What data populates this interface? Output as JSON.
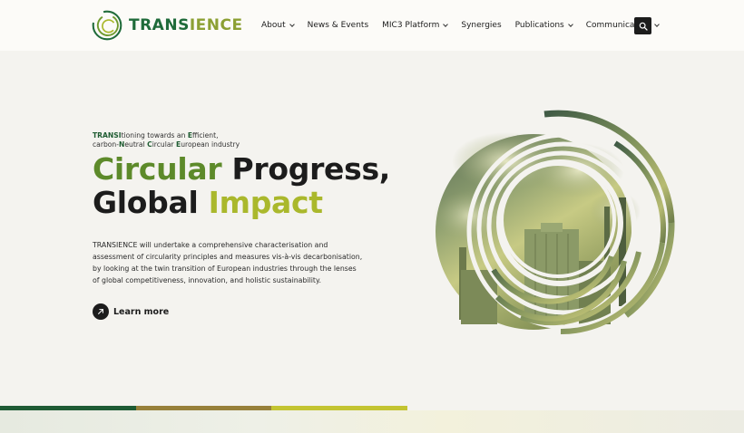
{
  "logo": {
    "text_part1": "TRANS",
    "text_part2": "IENCE",
    "brand_dark": "#1f6b3a",
    "brand_light": "#8ca033"
  },
  "nav": {
    "items": [
      {
        "label": "About",
        "has_dropdown": true
      },
      {
        "label": "News & Events",
        "has_dropdown": false
      },
      {
        "label": "MIC3 Platform",
        "has_dropdown": true
      },
      {
        "label": "Synergies",
        "has_dropdown": false
      },
      {
        "label": "Publications",
        "has_dropdown": true
      },
      {
        "label": "Communication",
        "has_dropdown": true
      }
    ],
    "search_icon": "search-icon"
  },
  "hero": {
    "tagline": {
      "line1": [
        {
          "text": "TRANSI",
          "bold": true
        },
        {
          "text": "tioning towards an ",
          "bold": false
        },
        {
          "text": "E",
          "bold": true
        },
        {
          "text": "fficient,",
          "bold": false
        }
      ],
      "line2": [
        {
          "text": "carbon-",
          "bold": false
        },
        {
          "text": "N",
          "bold": true
        },
        {
          "text": "eutral ",
          "bold": false
        },
        {
          "text": "C",
          "bold": true
        },
        {
          "text": "ircular ",
          "bold": false
        },
        {
          "text": "E",
          "bold": true
        },
        {
          "text": "uropean industry",
          "bold": false
        }
      ]
    },
    "headline_line1_a": "Circular",
    "headline_line1_b": " Progress,",
    "headline_line2_a": "Global",
    "headline_line2_b": " Impact",
    "description": "TRANSIENCE will undertake a comprehensive characterisation and assessment of circularity principles and measures vis-à-vis decarbonisation, by looking at the twin transition of European industries through the lenses of global competitiveness, innovation, and holistic sustainability.",
    "cta_label": "Learn more",
    "cta_icon": "arrow-up-right-icon"
  },
  "colors": {
    "headline_green": "#5d8a2a",
    "headline_lime": "#aab82c",
    "bar_green": "#1e5b34",
    "bar_brown": "#97803a",
    "bar_lime": "#c3c431"
  }
}
